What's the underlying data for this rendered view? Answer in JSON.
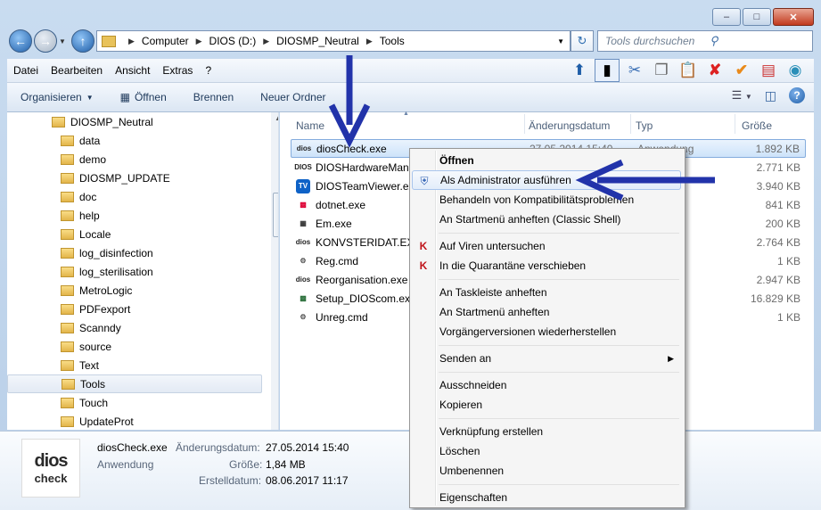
{
  "address": {
    "crumbs": [
      "Computer",
      "DIOS (D:)",
      "DIOSMP_Neutral",
      "Tools"
    ]
  },
  "search": {
    "placeholder": "Tools durchsuchen"
  },
  "menu": [
    "Datei",
    "Bearbeiten",
    "Ansicht",
    "Extras",
    "?"
  ],
  "commands": {
    "organize": "Organisieren",
    "open": "Öffnen",
    "burn": "Brennen",
    "new_folder": "Neuer Ordner"
  },
  "tree": {
    "root": "DIOSMP_Neutral",
    "items": [
      "data",
      "demo",
      "DIOSMP_UPDATE",
      "doc",
      "help",
      "Locale",
      "log_disinfection",
      "log_sterilisation",
      "MetroLogic",
      "PDFexport",
      "Scanndy",
      "source",
      "Text",
      "Tools",
      "Touch",
      "UpdateProt"
    ],
    "selected": "Tools"
  },
  "columns": {
    "name": "Name",
    "date": "Änderungsdatum",
    "type": "Typ",
    "size": "Größe"
  },
  "files": [
    {
      "name": "diosCheck.exe",
      "date": "27.05.2014 15:40",
      "type": "Anwendung",
      "size": "1.892 KB"
    },
    {
      "name": "DIOSHardwareManager.exe",
      "date": "",
      "type": "ng",
      "size": "2.771 KB"
    },
    {
      "name": "DIOSTeamViewer.exe",
      "date": "",
      "type": "ng",
      "size": "3.940 KB"
    },
    {
      "name": "dotnet.exe",
      "date": "",
      "type": "ng",
      "size": "841 KB"
    },
    {
      "name": "Em.exe",
      "date": "",
      "type": "ng",
      "size": "200 KB"
    },
    {
      "name": "KONVSTERIDAT.EXE",
      "date": "",
      "type": "ng",
      "size": "2.764 KB"
    },
    {
      "name": "Reg.cmd",
      "date": "",
      "type": "Befehlss...",
      "size": "1 KB"
    },
    {
      "name": "Reorganisation.exe",
      "date": "",
      "type": "ng",
      "size": "2.947 KB"
    },
    {
      "name": "Setup_DIOScom.exe",
      "date": "",
      "type": "ng",
      "size": "16.829 KB"
    },
    {
      "name": "Unreg.cmd",
      "date": "",
      "type": "Befehlss...",
      "size": "1 KB"
    }
  ],
  "details": {
    "filename": "diosCheck.exe",
    "type": "Anwendung",
    "mod_label": "Änderungsdatum:",
    "mod_value": "27.05.2014 15:40",
    "size_label": "Größe:",
    "size_value": "1,84 MB",
    "created_label": "Erstelldatum:",
    "created_value": "08.06.2017 11:17",
    "icon_text_1": "dios",
    "icon_text_2": "check"
  },
  "context_menu": {
    "open": "Öffnen",
    "run_as_admin": "Als Administrator ausführen",
    "compat": "Behandeln von Kompatibilitätsproblemen",
    "pin_start_classic": "An Startmenü anheften (Classic Shell)",
    "scan_virus": "Auf Viren untersuchen",
    "quarantine": "In die Quarantäne verschieben",
    "pin_taskbar": "An Taskleiste anheften",
    "pin_start": "An Startmenü anheften",
    "restore_versions": "Vorgängerversionen wiederherstellen",
    "send_to": "Senden an",
    "cut": "Ausschneiden",
    "copy": "Kopieren",
    "create_shortcut": "Verknüpfung erstellen",
    "delete": "Löschen",
    "rename": "Umbenennen",
    "properties": "Eigenschaften"
  },
  "colors": {
    "annotation_arrow": "#2233aa",
    "selection": "#cde3fa"
  }
}
